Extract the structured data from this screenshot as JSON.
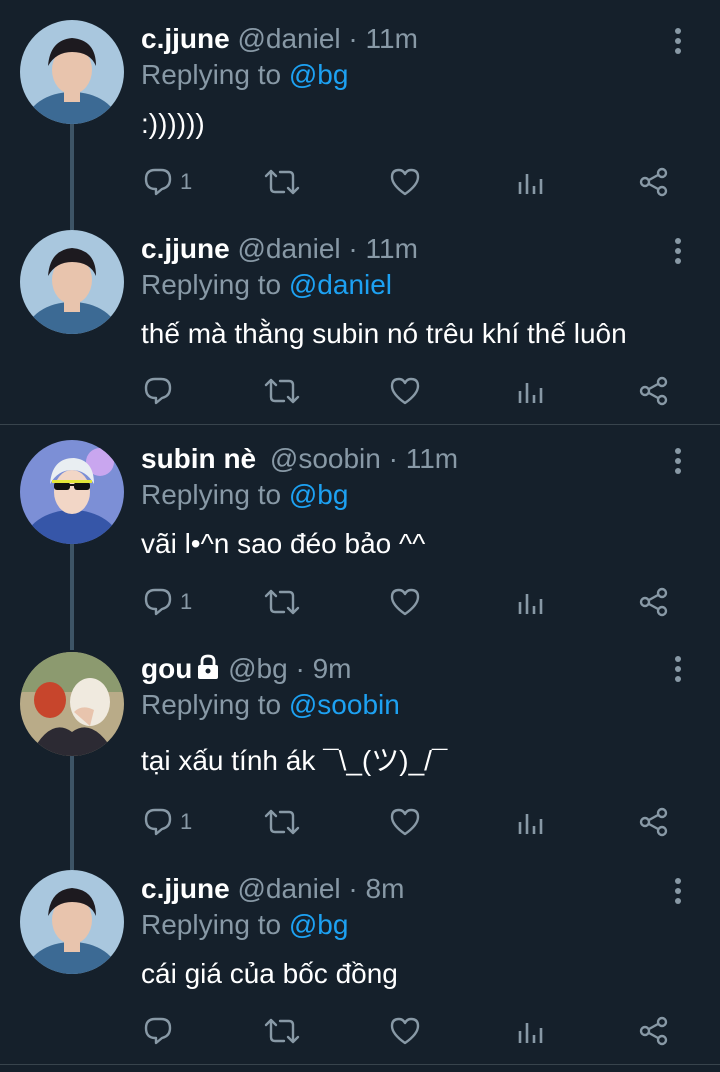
{
  "tweets": [
    {
      "name": "c.jjune",
      "handle": "@daniel",
      "time": "11m",
      "replying_prefix": "Replying to",
      "replying_to": "@bg",
      "text": ":))))))",
      "reply_count": "1",
      "avatar": "cjjune"
    },
    {
      "name": "c.jjune",
      "handle": "@daniel",
      "time": "11m",
      "replying_prefix": "Replying to",
      "replying_to": "@daniel",
      "text": "thế mà thằng subin nó trêu khí thế luôn",
      "reply_count": "",
      "avatar": "cjjune"
    },
    {
      "name": "subin nè",
      "handle": "@soobin",
      "time": "11m",
      "replying_prefix": "Replying to",
      "replying_to": "@bg",
      "text": "vãi l•^n sao đéo bảo ^^",
      "reply_count": "1",
      "avatar": "subin"
    },
    {
      "name": "gou",
      "handle": "@bg",
      "time": "9m",
      "replying_prefix": "Replying to",
      "replying_to": "@soobin",
      "text": "tại xấu tính ák ¯\\_(ツ)_/¯",
      "reply_count": "1",
      "avatar": "gou",
      "locked": true
    },
    {
      "name": "c.jjune",
      "handle": "@daniel",
      "time": "8m",
      "replying_prefix": "Replying to",
      "replying_to": "@bg",
      "text": "cái giá của bốc đồng",
      "reply_count": "",
      "avatar": "cjjune"
    }
  ],
  "dot": "·",
  "colors": {
    "background": "#15202b",
    "secondary_text": "#8899a6",
    "mention": "#1da1f2",
    "divider": "#38444d"
  },
  "icons": [
    "reply-icon",
    "retweet-icon",
    "like-icon",
    "analytics-icon",
    "share-icon",
    "more-vert-icon",
    "lock-icon"
  ]
}
